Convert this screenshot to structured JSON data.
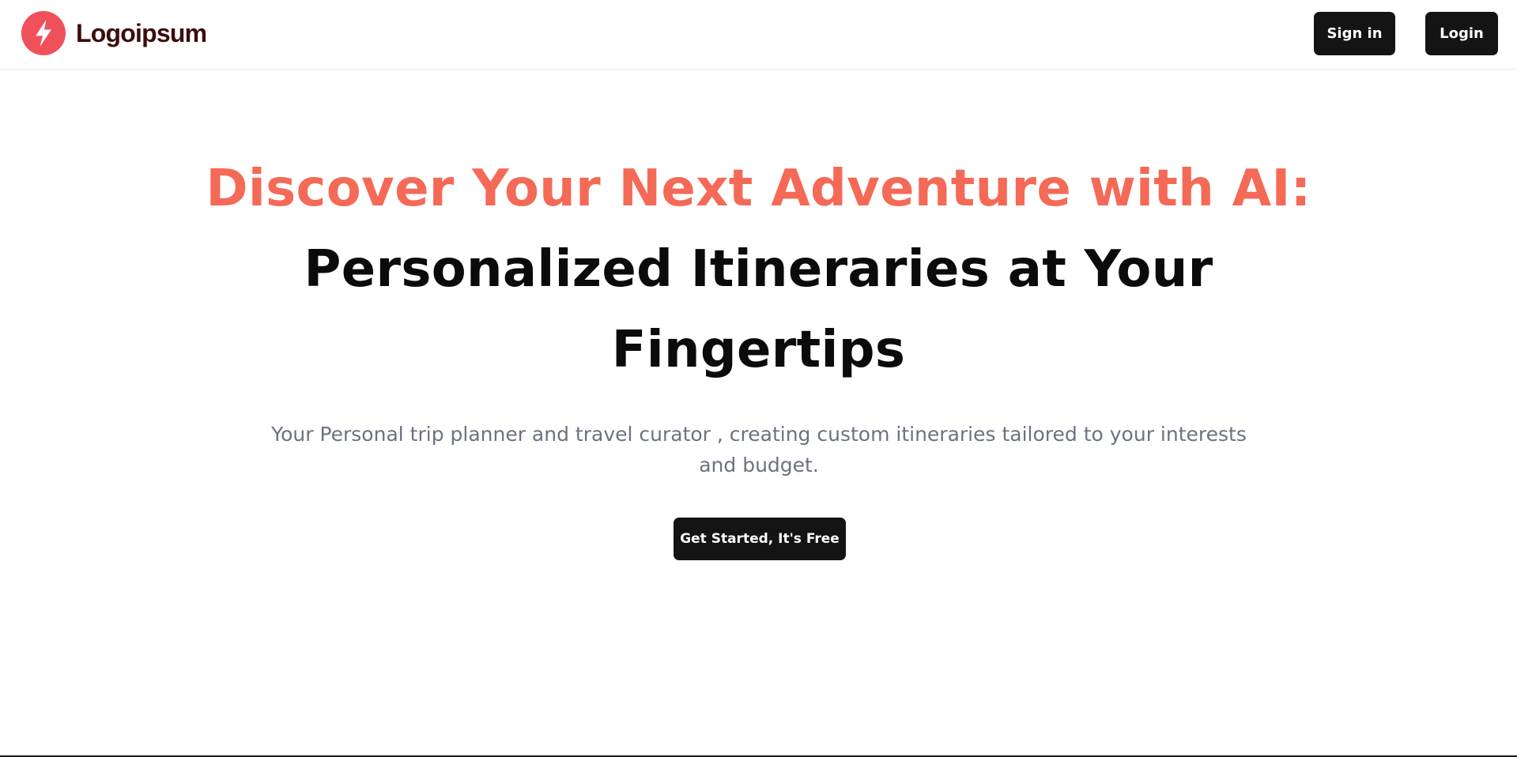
{
  "header": {
    "logo": {
      "text": "Logoipsum",
      "icon": "bolt-logo-icon",
      "icon_color": "#f0505a",
      "text_color": "#3b0d0d"
    },
    "nav": {
      "signin_label": "Sign in",
      "login_label": "Login"
    }
  },
  "hero": {
    "title_accent": "Discover Your Next Adventure with AI:",
    "title_line2": "Personalized Itineraries at Your",
    "title_line3": "Fingertips",
    "subtitle": "Your Personal trip planner and travel curator , creating custom itineraries tailored to your interests and budget.",
    "cta_label": "Get Started, It's Free"
  },
  "colors": {
    "accent": "#f46a57",
    "button_bg": "#141414",
    "subtitle_text": "#6b7280",
    "title_text": "#0b0b0b"
  }
}
